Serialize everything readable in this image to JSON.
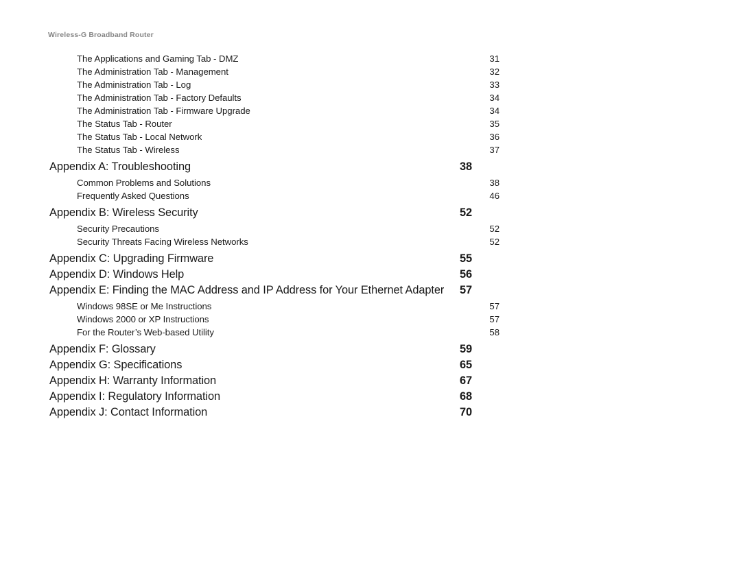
{
  "header": {
    "running_title": "Wireless-G Broadband Router",
    "color": "#858585"
  },
  "colors": {
    "text": "#1a1a1a",
    "header_gray": "#858585",
    "background": "#ffffff"
  },
  "toc": {
    "entries": [
      {
        "level": "sub",
        "label": "The Applications and Gaming Tab - DMZ",
        "page": "31"
      },
      {
        "level": "sub",
        "label": "The Administration Tab - Management",
        "page": "32"
      },
      {
        "level": "sub",
        "label": "The Administration Tab - Log",
        "page": "33"
      },
      {
        "level": "sub",
        "label": "The Administration Tab - Factory Defaults",
        "page": "34"
      },
      {
        "level": "sub",
        "label": "The Administration Tab - Firmware Upgrade",
        "page": "34"
      },
      {
        "level": "sub",
        "label": "The Status Tab - Router",
        "page": "35"
      },
      {
        "level": "sub",
        "label": "The Status Tab - Local Network",
        "page": "36"
      },
      {
        "level": "sub",
        "label": "The Status Tab - Wireless",
        "page": "37"
      },
      {
        "level": "main",
        "label": "Appendix A: Troubleshooting",
        "page": "38"
      },
      {
        "level": "sub",
        "label": "Common Problems and Solutions",
        "page": "38"
      },
      {
        "level": "sub",
        "label": "Frequently Asked Questions",
        "page": "46"
      },
      {
        "level": "main",
        "label": "Appendix B: Wireless Security",
        "page": "52"
      },
      {
        "level": "sub",
        "label": "Security Precautions",
        "page": "52"
      },
      {
        "level": "sub",
        "label": "Security Threats Facing Wireless Networks",
        "page": "52"
      },
      {
        "level": "main",
        "label": "Appendix C: Upgrading Firmware",
        "page": "55"
      },
      {
        "level": "main",
        "label": "Appendix D: Windows Help",
        "page": "56"
      },
      {
        "level": "main",
        "label": "Appendix E: Finding the MAC Address and IP Address for Your Ethernet Adapter",
        "page": "57"
      },
      {
        "level": "sub",
        "label": "Windows 98SE or Me Instructions",
        "page": "57"
      },
      {
        "level": "sub",
        "label": "Windows 2000 or XP Instructions",
        "page": "57"
      },
      {
        "level": "sub",
        "label": "For the Router’s Web-based Utility",
        "page": "58"
      },
      {
        "level": "main",
        "label": "Appendix F: Glossary",
        "page": "59"
      },
      {
        "level": "main",
        "label": "Appendix G: Specifications",
        "page": "65"
      },
      {
        "level": "main",
        "label": "Appendix H: Warranty Information",
        "page": "67"
      },
      {
        "level": "main",
        "label": "Appendix I: Regulatory Information",
        "page": "68"
      },
      {
        "level": "main",
        "label": "Appendix J: Contact Information",
        "page": "70"
      }
    ]
  }
}
